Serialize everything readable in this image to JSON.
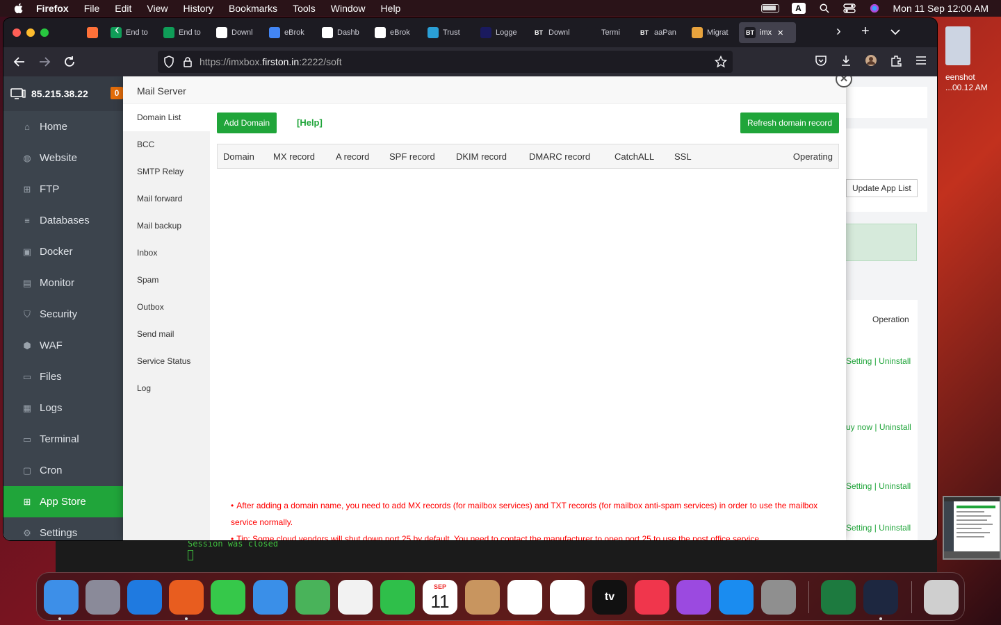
{
  "menubar": {
    "app": "Firefox",
    "menus": [
      "File",
      "Edit",
      "View",
      "History",
      "Bookmarks",
      "Tools",
      "Window",
      "Help"
    ],
    "input_source": "A",
    "clock": "Mon 11 Sep  12:00 AM"
  },
  "browser": {
    "tabs": [
      {
        "label": "",
        "icon": "firefox-view-icon"
      },
      {
        "label": "End to",
        "icon": "sheets-icon"
      },
      {
        "label": "End to",
        "icon": "sheets-icon"
      },
      {
        "label": "Downl",
        "icon": "download-icon"
      },
      {
        "label": "eBrok",
        "icon": "google-icon"
      },
      {
        "label": "Dashb",
        "icon": "dashboard-icon"
      },
      {
        "label": "eBrok",
        "icon": "doc-icon"
      },
      {
        "label": "Trust",
        "icon": "trust-icon"
      },
      {
        "label": "Logge",
        "icon": "vercel-icon"
      },
      {
        "label": "Downl",
        "icon": "bt-icon",
        "fav": "BT"
      },
      {
        "label": "Termi",
        "icon": "cloud-icon"
      },
      {
        "label": "aaPan",
        "icon": "bt-icon",
        "fav": "BT"
      },
      {
        "label": "Migrat",
        "icon": "migrate-icon"
      },
      {
        "label": "imx",
        "icon": "bt-icon",
        "fav": "BT",
        "active": true
      }
    ],
    "url_prefix": "https://imxbox.",
    "url_host": "firston.in",
    "url_suffix": ":2222/soft"
  },
  "panel": {
    "ip": "85.215.38.22",
    "badge": "0",
    "nav": [
      {
        "label": "Home",
        "icon": "home-icon"
      },
      {
        "label": "Website",
        "icon": "globe-icon"
      },
      {
        "label": "FTP",
        "icon": "ftp-icon"
      },
      {
        "label": "Databases",
        "icon": "database-icon"
      },
      {
        "label": "Docker",
        "icon": "docker-icon"
      },
      {
        "label": "Monitor",
        "icon": "monitor-icon"
      },
      {
        "label": "Security",
        "icon": "shield-icon"
      },
      {
        "label": "WAF",
        "icon": "waf-icon"
      },
      {
        "label": "Files",
        "icon": "folder-icon"
      },
      {
        "label": "Logs",
        "icon": "logs-icon"
      },
      {
        "label": "Terminal",
        "icon": "terminal-icon"
      },
      {
        "label": "Cron",
        "icon": "cron-icon"
      },
      {
        "label": "App Store",
        "icon": "grid-icon",
        "active": true
      },
      {
        "label": "Settings",
        "icon": "gear-icon"
      }
    ],
    "update_app_list": "Update App List",
    "operation_header": "Operation",
    "row_ops": [
      {
        "left": "Setting",
        "right": "Uninstall"
      },
      {
        "left": "uy now",
        "right": "Uninstall"
      },
      {
        "left": "Setting",
        "right": "Uninstall"
      },
      {
        "left": "Setting",
        "right": "Uninstall"
      }
    ]
  },
  "modal": {
    "title": "Mail Server",
    "nav": [
      "Domain List",
      "BCC",
      "SMTP Relay",
      "Mail forward",
      "Mail backup",
      "Inbox",
      "Spam",
      "Outbox",
      "Send mail",
      "Service Status",
      "Log"
    ],
    "active_nav": "Domain List",
    "add_domain": "Add Domain",
    "help": "[Help]",
    "refresh": "Refresh domain record",
    "columns": [
      "Domain",
      "MX record",
      "A record",
      "SPF record",
      "DKIM record",
      "DMARC record",
      "CatchALL",
      "SSL",
      "Operating"
    ],
    "tips": [
      "After adding a domain name, you need to add MX records (for mailbox services) and TXT records (for mailbox anti-spam services) in order to use the mailbox service normally.",
      "Tip: Some cloud vendors will shut down port 25 by default. You need to contact the manufacturer to open port 25 to use the post office service."
    ]
  },
  "terminal": {
    "line": "Session was closed"
  },
  "desktop": {
    "file_label_1": "eenshot",
    "file_label_2": "...00.12 AM"
  },
  "dock": {
    "apps": [
      "Finder",
      "Launchpad",
      "Safari",
      "Firefox",
      "Messages",
      "Mail",
      "Maps",
      "Photos",
      "FaceTime",
      "Calendar",
      "Contacts",
      "Reminders",
      "Freeform",
      "TV",
      "Music",
      "Podcasts",
      "App Store",
      "System Settings",
      "Excel",
      "Termius",
      "Trash"
    ],
    "calendar_month": "SEP",
    "calendar_day": "11",
    "tv_label": "tv"
  }
}
